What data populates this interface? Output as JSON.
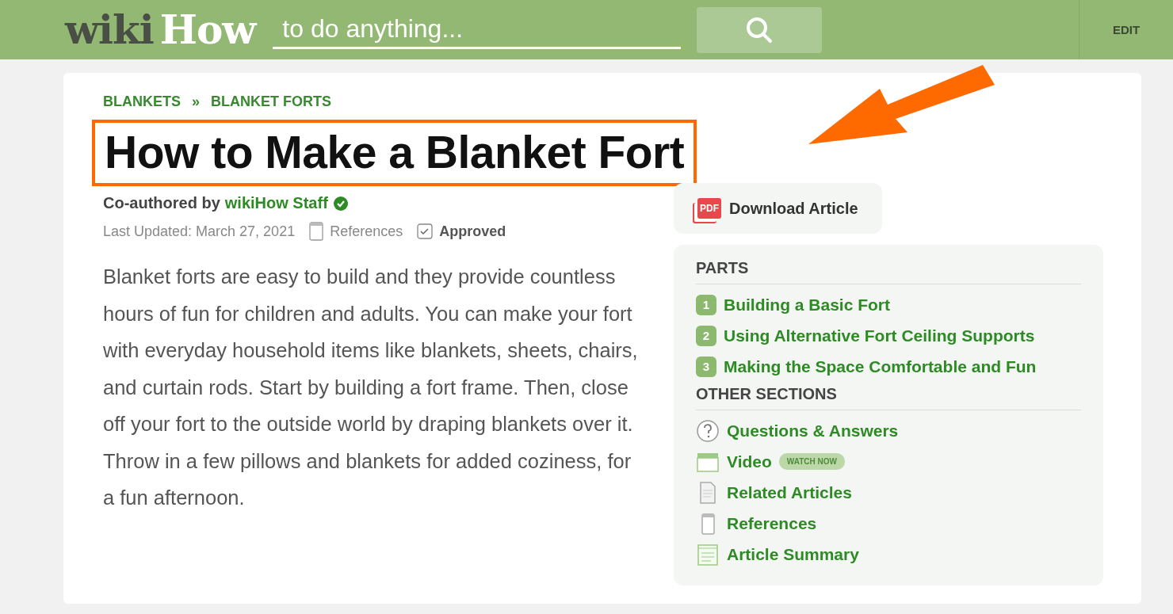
{
  "header": {
    "logo": {
      "first": "wiki",
      "second": "How"
    },
    "search": {
      "placeholder": "to do anything..."
    },
    "edit": "EDIT"
  },
  "breadcrumbs": [
    "BLANKETS",
    "BLANKET FORTS"
  ],
  "breadcrumb_separator": "»",
  "title": "How to Make a Blanket Fort",
  "title_highlighted": true,
  "byline": {
    "prefix": "Co-authored by",
    "author": "wikiHow Staff",
    "verified": true
  },
  "meta": {
    "updated": "Last Updated: March 27, 2021",
    "references": "References",
    "approved": "Approved"
  },
  "intro": "Blanket forts are easy to build and they provide countless hours of fun for children and adults. You can make your fort with everyday household items like blankets, sheets, chairs, and curtain rods. Start by building a fort frame. Then, close off your fort to the outside world by draping blankets over it. Throw in a few pillows and blankets for added coziness, for a fun afternoon.",
  "download": {
    "icon_text": "PDF",
    "label": "Download Article"
  },
  "toc": {
    "parts_heading": "PARTS",
    "parts": [
      {
        "number": "1",
        "label": "Building a Basic Fort"
      },
      {
        "number": "2",
        "label": "Using Alternative Fort Ceiling Supports"
      },
      {
        "number": "3",
        "label": "Making the Space Comfortable and Fun"
      }
    ],
    "other_heading": "OTHER SECTIONS",
    "sections": [
      {
        "kind": "question",
        "label": "Questions & Answers"
      },
      {
        "kind": "video",
        "label": "Video",
        "badge": "WATCH NOW"
      },
      {
        "kind": "related",
        "label": "Related Articles"
      },
      {
        "kind": "references",
        "label": "References"
      },
      {
        "kind": "summary",
        "label": "Article Summary"
      }
    ]
  }
}
